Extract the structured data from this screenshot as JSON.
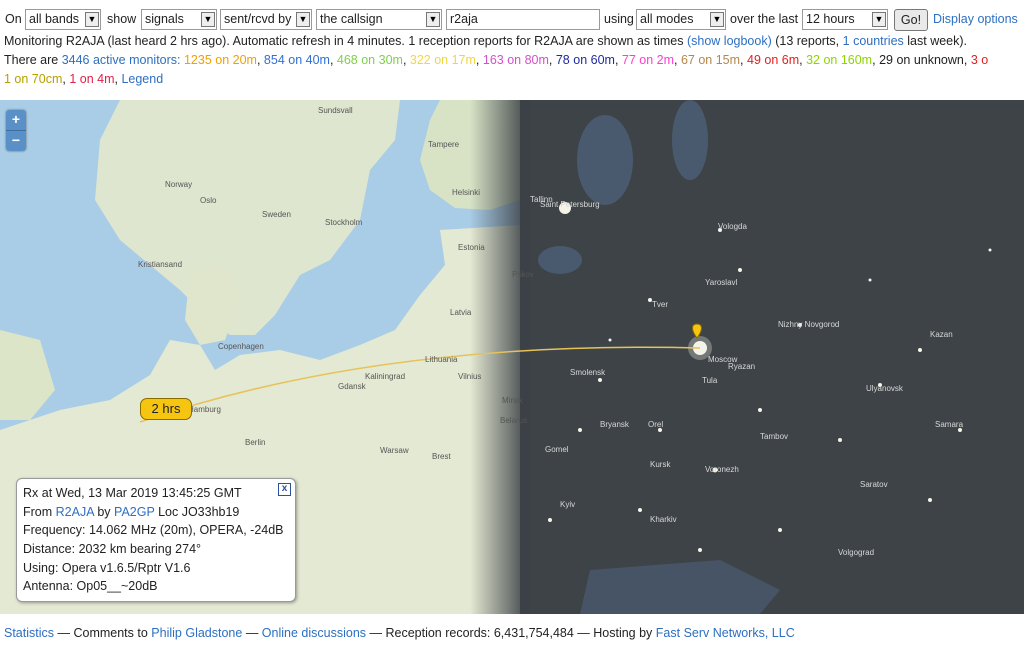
{
  "controls": {
    "on_label": "On",
    "band_value": "all bands",
    "show_label": "show",
    "show_value": "signals",
    "direction_value": "sent/rcvd by",
    "target_value": "the callsign",
    "callsign_value": "r2aja",
    "using_label": "using",
    "mode_value": "all modes",
    "over_label": "over the last",
    "period_value": "12 hours",
    "go_label": "Go!",
    "display_options_label": "Display options"
  },
  "status": {
    "monitoring_text": "Monitoring R2AJA (last heard 2 hrs ago). Automatic refresh in 4 minutes. 1 reception reports for R2AJA are shown as times",
    "show_logbook": "(show logbook)",
    "reports_text": "(13 reports,",
    "countries_link": "1 countries",
    "last_week": "last week)."
  },
  "monitors": {
    "there_are": "There are",
    "active_link": "3446 active monitors:",
    "bands": [
      {
        "text": "1235 on 20m",
        "color": "#f0a000"
      },
      {
        "text": "854 on 40m",
        "color": "#2f6fd8"
      },
      {
        "text": "468 on 30m",
        "color": "#7fd04a"
      },
      {
        "text": "322 on 17m",
        "color": "#f2d640"
      },
      {
        "text": "163 on 80m",
        "color": "#d64fc9"
      },
      {
        "text": "78 on 60m",
        "color": "#1f2a9c"
      },
      {
        "text": "77 on 2m",
        "color": "#ff3cc8"
      },
      {
        "text": "67 on 15m",
        "color": "#b7864a"
      },
      {
        "text": "49 on 6m",
        "color": "#e02020"
      },
      {
        "text": "32 on 160m",
        "color": "#8cd400"
      },
      {
        "text": "29 on unknown",
        "color": "#222222"
      },
      {
        "text": "3 o",
        "color": "#e02020"
      }
    ],
    "line4": [
      {
        "text": "1 on 70cm",
        "color": "#b8a000"
      },
      {
        "text": "1 on 4m",
        "color": "#e0204a"
      }
    ],
    "legend_link": "Legend"
  },
  "map": {
    "zoom_in": "+",
    "zoom_out": "−",
    "marker_label": "2 hrs",
    "places": [
      "Sundsvall",
      "Tampere",
      "Norway",
      "Oslo",
      "Helsinki",
      "Sweden",
      "Stockholm",
      "Kristiansand",
      "Tallinn",
      "Estonia",
      "Latvia",
      "Copenhagen",
      "Lithuania",
      "Kaliningrad",
      "Vilnius",
      "Gdansk",
      "Minsk",
      "Belarus",
      "Berlin",
      "Warsaw",
      "Brest",
      "Hamburg",
      "Vologda",
      "Yaroslavl",
      "Tver",
      "Nizhny Novgorod",
      "Kazan",
      "Ulyanovsk",
      "Samara",
      "Voronezh",
      "Saratov",
      "Tambov",
      "Orel",
      "Kursk",
      "Kharkiv",
      "Kyiv",
      "Volgograd",
      "Pskov",
      "Saint Petersburg",
      "Moscow",
      "Tula",
      "Ryazan",
      "Smolensk",
      "Bryansk",
      "Gomel"
    ]
  },
  "popup": {
    "line1": "Rx at Wed, 13 Mar 2019 13:45:25 GMT",
    "from_label": "From",
    "from_call": "R2AJA",
    "by_label": "by",
    "by_call": "PA2GP",
    "loc_text": "Loc JO33hb19",
    "frequency": "Frequency: 14.062 MHz (20m), OPERA, -24dB",
    "distance": "Distance: 2032 km bearing 274°",
    "using": "Using: Opera v1.6.5/Rptr V1.6",
    "antenna": "Antenna: Op05__~20dB",
    "close": "x"
  },
  "footer": {
    "statistics": "Statistics",
    "comments": "— Comments to",
    "author": "Philip Gladstone",
    "sep1": "—",
    "online": "Online discussions",
    "records": "— Reception records: 6,431,754,484 — Hosting by",
    "host": "Fast Serv Networks, LLC"
  }
}
